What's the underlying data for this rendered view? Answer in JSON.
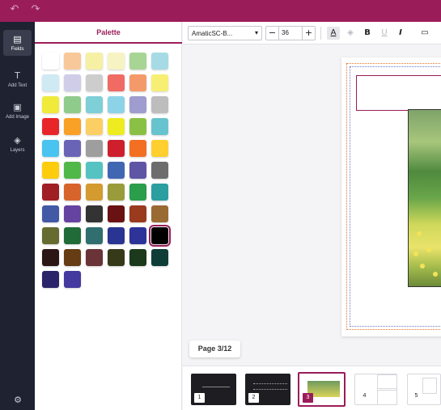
{
  "topbar": {
    "undo_icon": "undo-icon",
    "redo_icon": "redo-icon",
    "brand_color": "#9a1d5a"
  },
  "sidebar": {
    "items": [
      {
        "label": "Fields",
        "icon": "fields-icon",
        "active": true
      },
      {
        "label": "Add Text",
        "icon": "text-icon",
        "active": false
      },
      {
        "label": "Add Image",
        "icon": "image-icon",
        "active": false
      },
      {
        "label": "Layers",
        "icon": "layers-icon",
        "active": false
      }
    ],
    "settings_icon": "gear-icon"
  },
  "palette": {
    "title": "Palette",
    "selected": "#000000",
    "colors": [
      "#ffffff",
      "#f9c89a",
      "#f5f0a4",
      "#f7f3c2",
      "#a8d593",
      "#a6dbe5",
      "#cfeaf3",
      "#cfcde8",
      "#cdcdcd",
      "#ef6b63",
      "#f49a6a",
      "#f7ef73",
      "#f0ea3b",
      "#8fcb8b",
      "#7fcfd6",
      "#8dd3e8",
      "#9f9ccf",
      "#bdbdbd",
      "#e8262a",
      "#f9a126",
      "#fbcf64",
      "#eeeb20",
      "#8ac144",
      "#67c4ce",
      "#49c3ef",
      "#6a64b7",
      "#9e9e9e",
      "#cd202c",
      "#f36f21",
      "#fecf2e",
      "#fdcc0c",
      "#50b848",
      "#55c3c2",
      "#4167b3",
      "#5f55a5",
      "#6d6d6d",
      "#a01f24",
      "#d7652b",
      "#d39b30",
      "#9a9c3b",
      "#2a9e4a",
      "#2b9ea0",
      "#4259a6",
      "#6543a0",
      "#333333",
      "#6a1113",
      "#9a3a1e",
      "#9a6a33",
      "#666b30",
      "#206b38",
      "#306e6f",
      "#2a3492",
      "#2e3399",
      "#000000",
      "#2c1515",
      "#653c13",
      "#6a3338",
      "#363a19",
      "#1b3a1c",
      "#0e3d37",
      "#2a236a",
      "#43399e"
    ]
  },
  "toolbar": {
    "font_name": "AmaticSC-B...",
    "font_chevron": "▾",
    "font_size": "36",
    "minus_label": "−",
    "plus_label": "+",
    "text_color_label": "A",
    "bold_label": "B",
    "underline_label": "U",
    "italic_label": "I"
  },
  "canvas": {
    "page_indicator": "Page 3/12"
  },
  "thumbnails": [
    {
      "num": "1",
      "style": "dark"
    },
    {
      "num": "2",
      "style": "dark"
    },
    {
      "num": "3",
      "style": "active"
    },
    {
      "num": "4",
      "style": "light-grid"
    },
    {
      "num": "5",
      "style": "light-grid"
    }
  ]
}
